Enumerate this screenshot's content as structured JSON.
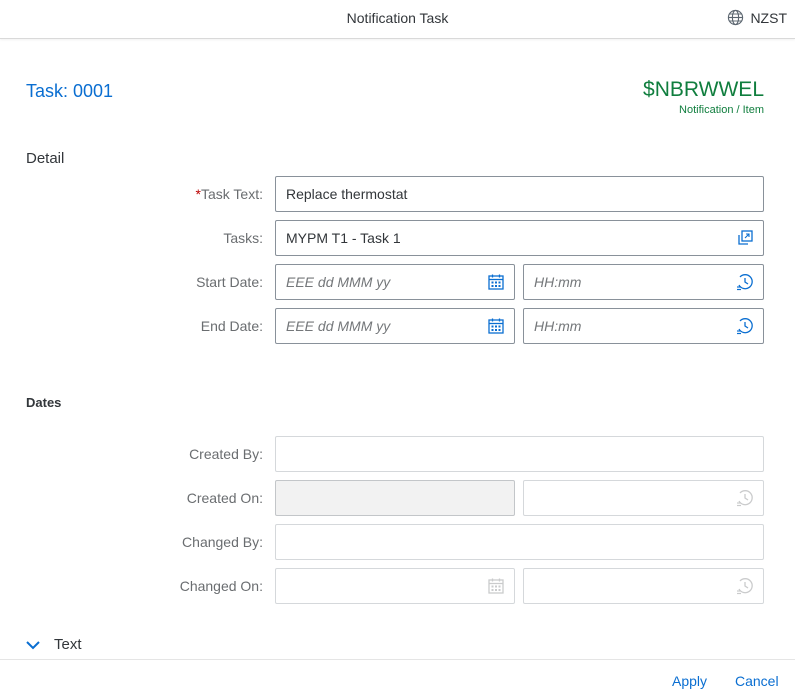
{
  "header": {
    "title": "Notification Task",
    "timezone": "NZST"
  },
  "object": {
    "title": "Task: 0001",
    "id": "$NBRWWEL",
    "subtitle": "Notification / Item"
  },
  "detail": {
    "section_title": "Detail",
    "task_text": {
      "required_mark": "*",
      "label": "Task Text:",
      "value": "Replace thermostat"
    },
    "tasks": {
      "label": "Tasks:",
      "value": "MYPM T1 - Task 1"
    },
    "start_date": {
      "label": "Start Date:",
      "date_placeholder": "EEE dd MMM yy",
      "time_placeholder": "HH:mm"
    },
    "end_date": {
      "label": "End Date:",
      "date_placeholder": "EEE dd MMM yy",
      "time_placeholder": "HH:mm"
    }
  },
  "dates": {
    "section_title": "Dates",
    "created_by": {
      "label": "Created By:",
      "value": ""
    },
    "created_on": {
      "label": "Created On:",
      "value": ""
    },
    "changed_by": {
      "label": "Changed By:",
      "value": ""
    },
    "changed_on": {
      "label": "Changed On:",
      "value": ""
    }
  },
  "text_section": {
    "title": "Text"
  },
  "footer": {
    "apply_label": "Apply",
    "cancel_label": "Cancel"
  },
  "colors": {
    "link": "#0a6ed1",
    "object_id": "#107e3e",
    "required": "#bb0000"
  },
  "icons": [
    "globe-icon",
    "value-help-icon",
    "calendar-icon",
    "time-icon",
    "chevron-down-icon"
  ]
}
